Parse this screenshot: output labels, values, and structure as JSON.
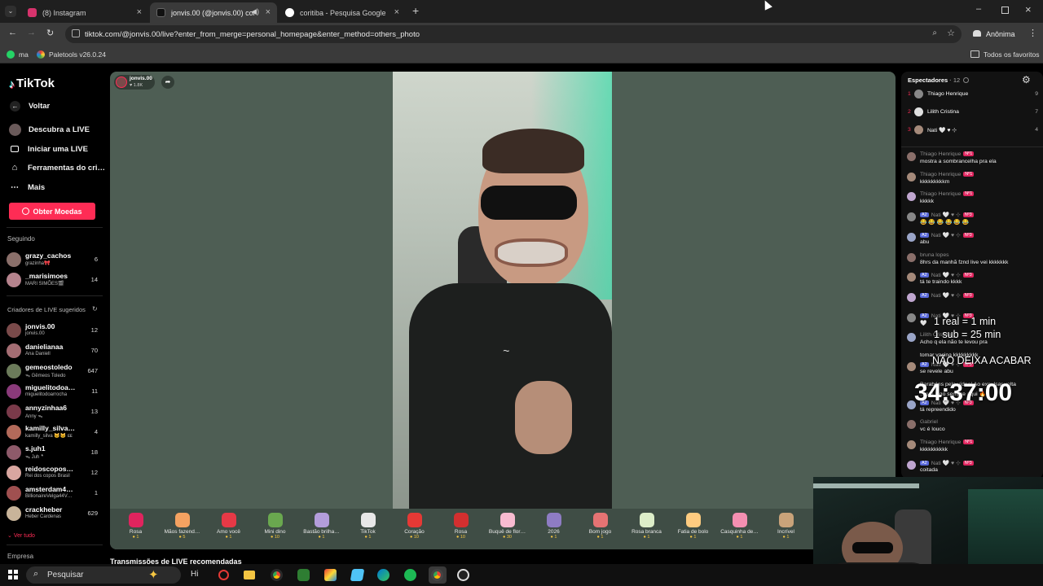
{
  "browser": {
    "tabs": [
      {
        "label": "(8) Instagram",
        "icon": "instagram-icon",
        "color": "#d6336c"
      },
      {
        "label": "jonvis.00 (@jonvis.00) com…",
        "icon": "tiktok-icon",
        "color": "#111111"
      },
      {
        "label": "coritiba - Pesquisa Google",
        "icon": "google-icon",
        "color": "#ffffff"
      }
    ],
    "url": "tiktok.com/@jonvis.00/live?enter_from_merge=personal_homepage&enter_method=others_photo",
    "profile_label": "Anônima",
    "bookmarks": [
      {
        "label": "ma",
        "icon": "whatsapp-icon"
      },
      {
        "label": "Paletools v26.0.24",
        "icon": "palette-icon"
      }
    ],
    "all_bookmarks_label": "Todos os favoritos"
  },
  "sidebar": {
    "logo": "TikTok",
    "back_label": "Voltar",
    "nav": [
      {
        "label": "Descubra a LIVE",
        "icon": "live-avatar-icon"
      },
      {
        "label": "Iniciar uma LIVE",
        "icon": "camera-icon"
      },
      {
        "label": "Ferramentas do cri…",
        "icon": "home-icon"
      },
      {
        "label": "Mais",
        "icon": "more-icon"
      }
    ],
    "coins_button": "Obter Moedas",
    "following_heading": "Seguindo",
    "following": [
      {
        "name": "grazy_cachos",
        "sub": "grazinha🎀",
        "count": "6"
      },
      {
        "name": "_marisimoes",
        "sub": "MARI SIMÕES🎬",
        "count": "14"
      }
    ],
    "suggested_heading": "Criadores de LIVE sugeridos",
    "suggested": [
      {
        "name": "jonvis.00",
        "sub": "jonvis.00",
        "count": "12"
      },
      {
        "name": "danielianaa",
        "sub": "Ana Daniell",
        "count": "70"
      },
      {
        "name": "gemeostoledo",
        "sub": "ᯓ Gêmeos Toledo",
        "count": "647"
      },
      {
        "name": "miguelitodoa…",
        "sub": "miguelitodoarrocha",
        "count": "11"
      },
      {
        "name": "annyzinhaa6",
        "sub": "Anny ᯓ",
        "count": "13"
      },
      {
        "name": "kamilly_silva…",
        "sub": "kamilly_silva 🐱🐱 ᴇᴇ",
        "count": "4"
      },
      {
        "name": "s.juh1",
        "sub": "ᯓ Juh ؞",
        "count": "18"
      },
      {
        "name": "reidoscopos…",
        "sub": "Rei dos copos Brasil",
        "count": "12"
      },
      {
        "name": "amsterdam4…",
        "sub": "BillionaireVelga44V…",
        "count": "1"
      },
      {
        "name": "crackheber",
        "sub": "Heber Cardenas",
        "count": "629"
      }
    ],
    "see_all": "Ver tudo",
    "company": "Empresa"
  },
  "stream": {
    "host_name": "jonvis.00",
    "host_likes": "1.8K",
    "recommended_heading": "Transmissões de LIVE recomendadas"
  },
  "gifts": [
    {
      "name": "Rosa",
      "price": "1"
    },
    {
      "name": "Mãos fazend…",
      "price": "5"
    },
    {
      "name": "Amo você",
      "price": "1"
    },
    {
      "name": "Mini dino",
      "price": "10"
    },
    {
      "name": "Bastão brilha…",
      "price": "1"
    },
    {
      "name": "TikTok",
      "price": "1"
    },
    {
      "name": "Coração",
      "price": "10"
    },
    {
      "name": "Rosa",
      "price": "10"
    },
    {
      "name": "Buquê de flor…",
      "price": "30"
    },
    {
      "name": "2026",
      "price": "1"
    },
    {
      "name": "Bom jogo",
      "price": "1"
    },
    {
      "name": "Rosa branca",
      "price": "1"
    },
    {
      "name": "Fatia de bolo",
      "price": "1"
    },
    {
      "name": "Casquinha de…",
      "price": "1"
    },
    {
      "name": "Incrível",
      "price": "1"
    }
  ],
  "chat": {
    "viewers_label": "Espectadores",
    "viewers_count": "12",
    "top_viewers": [
      {
        "rank": "1",
        "name": "Thiago Henrique",
        "score": "9"
      },
      {
        "rank": "2",
        "name": "Lilith Cristina",
        "score": "7"
      },
      {
        "rank": "3",
        "name": "Nati 🤍 ♥ ⊹",
        "score": "4"
      }
    ],
    "messages": [
      {
        "user": "Thiago Henrique",
        "badge": "Nº1",
        "text": "mostra a sombrancelha pra ela"
      },
      {
        "user": "Thiago Henrique",
        "badge": "Nº1",
        "text": "kkkkkkkkkm"
      },
      {
        "user": "Thiago Henrique",
        "badge": "Nº1",
        "text": "kkkkk"
      },
      {
        "user": "Nati 🤍 ♥ ⊹",
        "badge": "Nº3",
        "text": "😂 😂 😂 😂 😂 😂"
      },
      {
        "user": "Nati 🤍 ♥ ⊹",
        "badge": "Nº3",
        "text": "abu"
      },
      {
        "user": "bruna lopes",
        "badge": "",
        "text": "8hrs da manhã fznd live vei kkkkkkk"
      },
      {
        "user": "Nati 🤍 ♥ ⊹",
        "badge": "Nº3",
        "text": "tá te traindo kkkk"
      },
      {
        "user": "Nati 🤍 ♥ ⊹",
        "badge": "Nº3",
        "text": ""
      },
      {
        "user": "Nati 🤍 ♥ ⊹",
        "badge": "Nº3",
        "text": "🤍"
      },
      {
        "user": "Lilith Cristina",
        "badge": "",
        "text": "Acho q ela não te levou pra"
      },
      {
        "user": "",
        "badge": "",
        "text": "tomar vacina kkkkkkkkk"
      },
      {
        "user": "Nati 🤍 ♥ ⊹",
        "badge": "Nº3",
        "text": "se revele abu"
      },
      {
        "user": "",
        "badge": "",
        "text": "Parabéns pelo vídeo! Ao expulsar volta"
      },
      {
        "user": "",
        "badge": "",
        "text": "…pra jogo sempre aqui 🔥"
      },
      {
        "user": "Nati 🤍 ♥ ⊹",
        "badge": "Nº3",
        "text": "tá repreendido"
      },
      {
        "user": "Gabriel",
        "badge": "",
        "text": "vc é louco"
      },
      {
        "user": "Thiago Henrique",
        "badge": "Nº1",
        "text": "kkkkkkkkkk"
      },
      {
        "user": "Nati 🤍 ♥ ⊹",
        "badge": "Nº3",
        "text": "coitada"
      }
    ]
  },
  "overlay": {
    "line1": "1 real = 1 min",
    "line2": "1 sub = 25 min",
    "line3": "NÃO DEIXA ACABAR",
    "timer": "34:37:00"
  },
  "taskbar": {
    "search_label": "Pesquisar",
    "hi_label": "Hi"
  },
  "colors": {
    "accent_red": "#fe2c55",
    "player_bg": "#4e5e54",
    "badge_red": "#e0245e"
  }
}
